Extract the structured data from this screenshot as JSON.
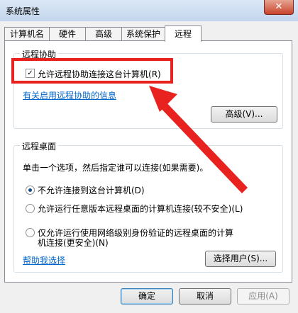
{
  "window": {
    "title": "系统属性",
    "close_label": "✕"
  },
  "tabs": [
    {
      "label": "计算机名"
    },
    {
      "label": "硬件"
    },
    {
      "label": "高级"
    },
    {
      "label": "系统保护"
    },
    {
      "label": "远程",
      "active": true
    }
  ],
  "remote_assistance": {
    "group_title": "远程协助",
    "allow_checkbox_label": "允许远程协助连接这台计算机",
    "allow_checkbox_shortcut": "(R)",
    "allow_checked": true,
    "info_link": "有关启用远程协助的信息",
    "advanced_button": "高级(V)..."
  },
  "remote_desktop": {
    "group_title": "远程桌面",
    "instruction": "单击一个选项，然后指定谁可以连接(如果需要)。",
    "options": [
      {
        "label": "不允许连接到这台计算机(D)",
        "selected": true
      },
      {
        "label": "允许运行任意版本远程桌面的计算机连接(较不安全)(L)",
        "selected": false
      },
      {
        "label_line1": "仅允许运行使用网络级别身份验证的远程桌面的计算",
        "label_line2": "机连接(更安全)(N)",
        "selected": false
      }
    ],
    "help_link": "帮助我选择",
    "select_users_button": "选择用户(S)..."
  },
  "footer": {
    "ok_button": "确定",
    "cancel_button": "取消",
    "apply_button": "应用(A)"
  },
  "annotation": {
    "highlight_color": "#e8231f"
  }
}
